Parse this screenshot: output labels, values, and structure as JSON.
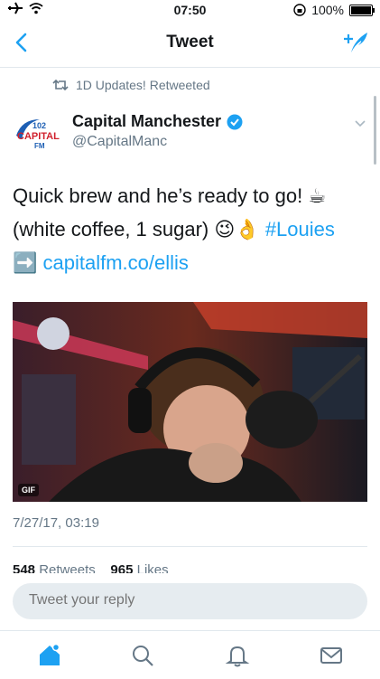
{
  "status": {
    "time": "07:50",
    "battery": "100%"
  },
  "nav": {
    "title": "Tweet"
  },
  "retweet": {
    "label": "1D Updates! Retweeted"
  },
  "author": {
    "name": "Capital Manchester",
    "handle": "@CapitalManc",
    "logo_top": "102",
    "logo_mid": "CAPITAL",
    "logo_bottom": "FM"
  },
  "tweet": {
    "line1": "Quick brew and he’s ready to go! ☕",
    "line2_text": "(white coffee, 1 sugar) 😉👌 ",
    "hashtag": "#Louies",
    "arrow": "➡️ ",
    "link": "capitalfm.co/ellis",
    "media_badge": "GIF",
    "timestamp": "7/27/17, 03:19"
  },
  "stats": {
    "retweets_count": "548",
    "retweets_label": "Retweets",
    "likes_count": "965",
    "likes_label": "Likes"
  },
  "reply": {
    "placeholder": "Tweet your reply"
  },
  "colors": {
    "accent": "#1da1f2",
    "muted": "#657786",
    "verified": "#1da1f2"
  },
  "icons": [
    "airplane-icon",
    "wifi-icon",
    "lock-rotation-icon",
    "back-chevron-icon",
    "compose-icon",
    "retweet-icon",
    "verified-icon",
    "caret-down-icon",
    "home-icon",
    "search-icon",
    "notifications-icon",
    "messages-icon"
  ]
}
